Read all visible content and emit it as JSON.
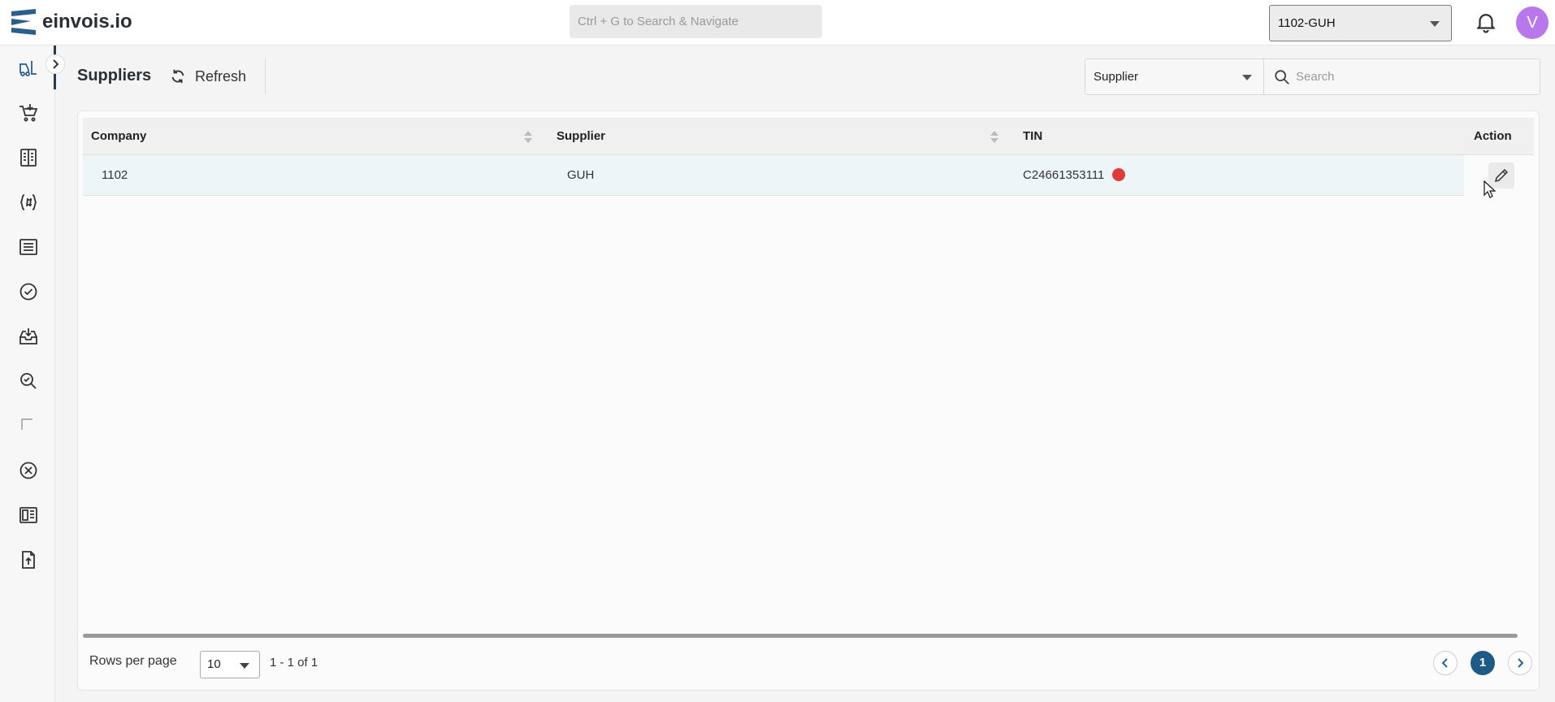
{
  "app": {
    "logo_text": "einvois.io",
    "global_search_placeholder": "Ctrl + G to Search & Navigate",
    "tenant": "1102-GUH",
    "user_initial": "V"
  },
  "sidebar": {
    "items": [
      {
        "name": "suppliers",
        "icon": "forklift-icon",
        "active": true
      },
      {
        "name": "purchases",
        "icon": "cart-icon"
      },
      {
        "name": "documents",
        "icon": "ledger-icon"
      },
      {
        "name": "codes",
        "icon": "code-braces-icon"
      },
      {
        "name": "list",
        "icon": "list-icon"
      },
      {
        "name": "approved",
        "icon": "check-circle-icon"
      },
      {
        "name": "inbox",
        "icon": "inbox-download-icon"
      },
      {
        "name": "inspect",
        "icon": "search-check-icon"
      },
      {
        "name": "placeholder",
        "icon": "corner-icon"
      },
      {
        "name": "rejected",
        "icon": "x-circle-icon"
      },
      {
        "name": "dashboard",
        "icon": "layout-icon"
      },
      {
        "name": "upload",
        "icon": "file-upload-icon"
      }
    ]
  },
  "page": {
    "title": "Suppliers",
    "refresh_label": "Refresh",
    "filter_field": "Supplier",
    "search_placeholder": "Search"
  },
  "table": {
    "columns": [
      "Company",
      "Supplier",
      "TIN",
      "Action"
    ],
    "rows": [
      {
        "company": "1102",
        "supplier": "GUH",
        "tin": "C24661353111",
        "tin_status_color": "#e03a3a"
      }
    ]
  },
  "pagination": {
    "rows_per_page_label": "Rows per page",
    "rows_per_page": "10",
    "range": "1 - 1 of 1",
    "current_page": "1",
    "prev_icon": "chevron-left-icon",
    "next_icon": "chevron-right-icon"
  },
  "colors": {
    "accent": "#1f5a86",
    "status_error": "#e03a3a",
    "avatar": "#b977ec"
  }
}
